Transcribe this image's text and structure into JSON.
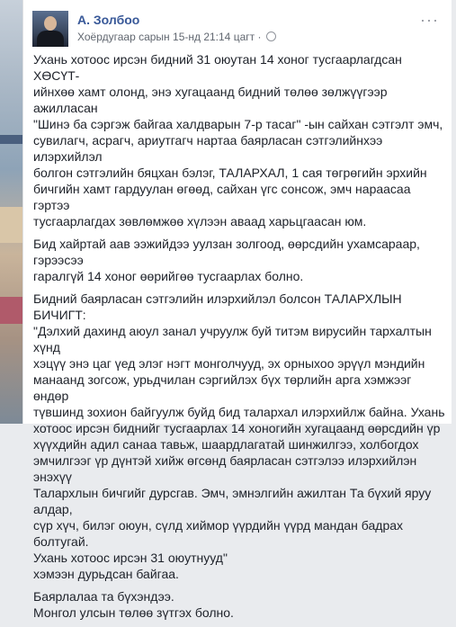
{
  "post": {
    "author": "А. Золбоо",
    "meta": "Хоёрдугаар сарын 15-нд 21:14 цагт ·",
    "more_label": "···",
    "paragraphs": [
      "Ухань хотоос ирсэн бидний 31 оюутан 14 хоног тусгаарлагдсан ХӨСҮТ-\nийнхөө хамт олонд, энэ хугацаанд бидний төлөө зөлжүүгээр ажилласан\n\"Шинэ ба сэргэж байгаа халдварын 7-р тасаг\" -ын сайхан сэтгэлт эмч,\nсувилагч, асрагч, ариутгагч нартаа баярласан сэтгэлийнхээ илэрхийлэл\nболгон сэтгэлийн бяцхан бэлэг, ТАЛАРХАЛ, 1 сая төгрөгийн эрхийн\nбичгийн хамт гардуулан өгөөд, сайхан үгс сонсож, эмч нараасаа гэртээ\nтусгаарлагдах зөвлөмжөө хүлээн аваад харьцгаасан юм.",
      "Бид хайртай аав ээжийдээ уулзан золгоод, өөрсдийн ухамсараар, гэрээсээ\nгаралгүй 14 хоног өөрийгөө тусгаарлах болно.",
      "Бидний баярласан сэтгэлийн илэрхийлэл болсон ТАЛАРХЛЫН БИЧИГТ:\n\"Дэлхий дахинд аюул занал учруулж буй титэм вирусийн тархалтын хүнд\nхэцүү энэ цаг үед элэг нэгт монголчууд, эх орныхоо эрүүл мэндийн\nманаанд зогсож, урьдчилан сэргийлэх бүх төрлийн арга хэмжээг өндөр\nтүвшинд зохион байгуулж буйд бид талархал илэрхийлж байна. Ухань\nхотоос ирсэн биднийг тусгаарлах 14 хоногийн хугацаанд өөрсдийн үр\nхүүхдийн адил санаа тавьж, шаардлагатай шинжилгээ, холбогдох\nэмчилгээг үр дүнтэй хийж өгсөнд баярласан сэтгэлээ илэрхийлэн энэхүү\nТалархлын бичгийг дурсгав. Эмч, эмнэлгийн ажилтан Та бүхий яруу алдар,\nсүр хүч, билэг оюун, сүлд хиймор үүрдийн үүрд мандан бадрах болтугай.\nУхань хотоос ирсэн 31 оюутнууд\"\nхэмээн дурьдсан байгаа.",
      "Баярлалаа та бүхэндээ.\nМонгол улсын төлөө зүтгэх болно."
    ]
  }
}
